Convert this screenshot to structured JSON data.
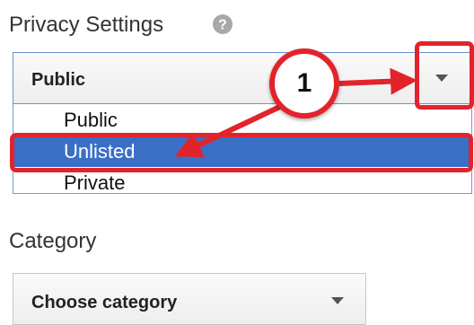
{
  "privacy": {
    "title": "Privacy Settings",
    "help_icon": "question-circle-icon",
    "selected_value": "Public",
    "options": [
      "Public",
      "Unlisted",
      "Private"
    ],
    "highlighted_option": "Unlisted"
  },
  "annotation": {
    "step_number": "1",
    "color": "#e3232b"
  },
  "category": {
    "title": "Category",
    "selected_value": "Choose category"
  },
  "colors": {
    "selected_option_bg": "#3a6fc6",
    "annotation_red": "#e3232b"
  }
}
